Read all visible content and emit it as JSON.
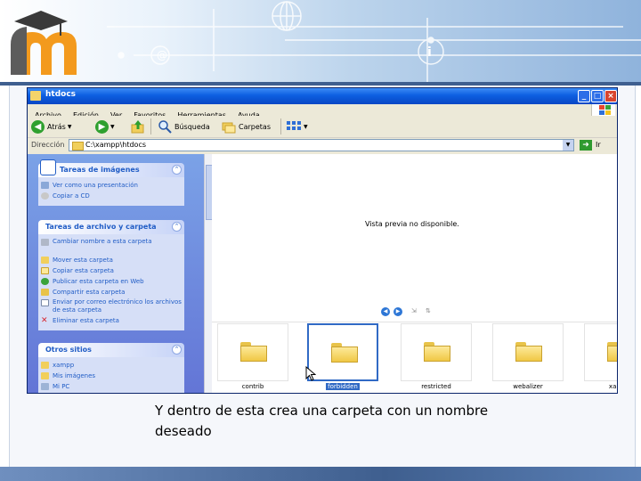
{
  "window": {
    "title": "htdocs",
    "buttons": {
      "minimize": "_",
      "maximize": "□",
      "close": "×"
    }
  },
  "menu": [
    "Archivo",
    "Edición",
    "Ver",
    "Favoritos",
    "Herramientas",
    "Ayuda"
  ],
  "toolbar": {
    "back_label": "Atrás",
    "search_label": "Búsqueda",
    "folders_label": "Carpetas"
  },
  "address": {
    "label": "Dirección",
    "path": "C:\\xampp\\htdocs",
    "go_label": "Ir"
  },
  "taskpane": {
    "image_tasks": {
      "title": "Tareas de imágenes",
      "items": [
        "Ver como una presentación",
        "Copiar a CD"
      ]
    },
    "file_tasks": {
      "title": "Tareas de archivo y carpeta",
      "items": [
        "Cambiar nombre a esta carpeta",
        "Mover esta carpeta",
        "Copiar esta carpeta",
        "Publicar esta carpeta en Web",
        "Compartir esta carpeta",
        "Enviar por correo electrónico los archivos de esta carpeta",
        "Eliminar esta carpeta"
      ]
    },
    "other_places": {
      "title": "Otros sitios",
      "items": [
        "xampp",
        "Mis imágenes",
        "Mi PC"
      ]
    }
  },
  "content": {
    "preview_text": "Vista previa no disponible.",
    "thumbnails": [
      {
        "label": "contrib",
        "selected": false
      },
      {
        "label": "forbidden",
        "selected": true
      },
      {
        "label": "restricted",
        "selected": false
      },
      {
        "label": "webalizer",
        "selected": false
      },
      {
        "label": "xampp",
        "selected": false
      }
    ]
  },
  "caption": "Y dentro de esta crea una carpeta con un nombre deseado",
  "colors": {
    "xp_blue": "#0d5fe1",
    "task_blue": "#215dc6",
    "selection": "#316ac5",
    "header_rule": "#3f5f8f"
  }
}
